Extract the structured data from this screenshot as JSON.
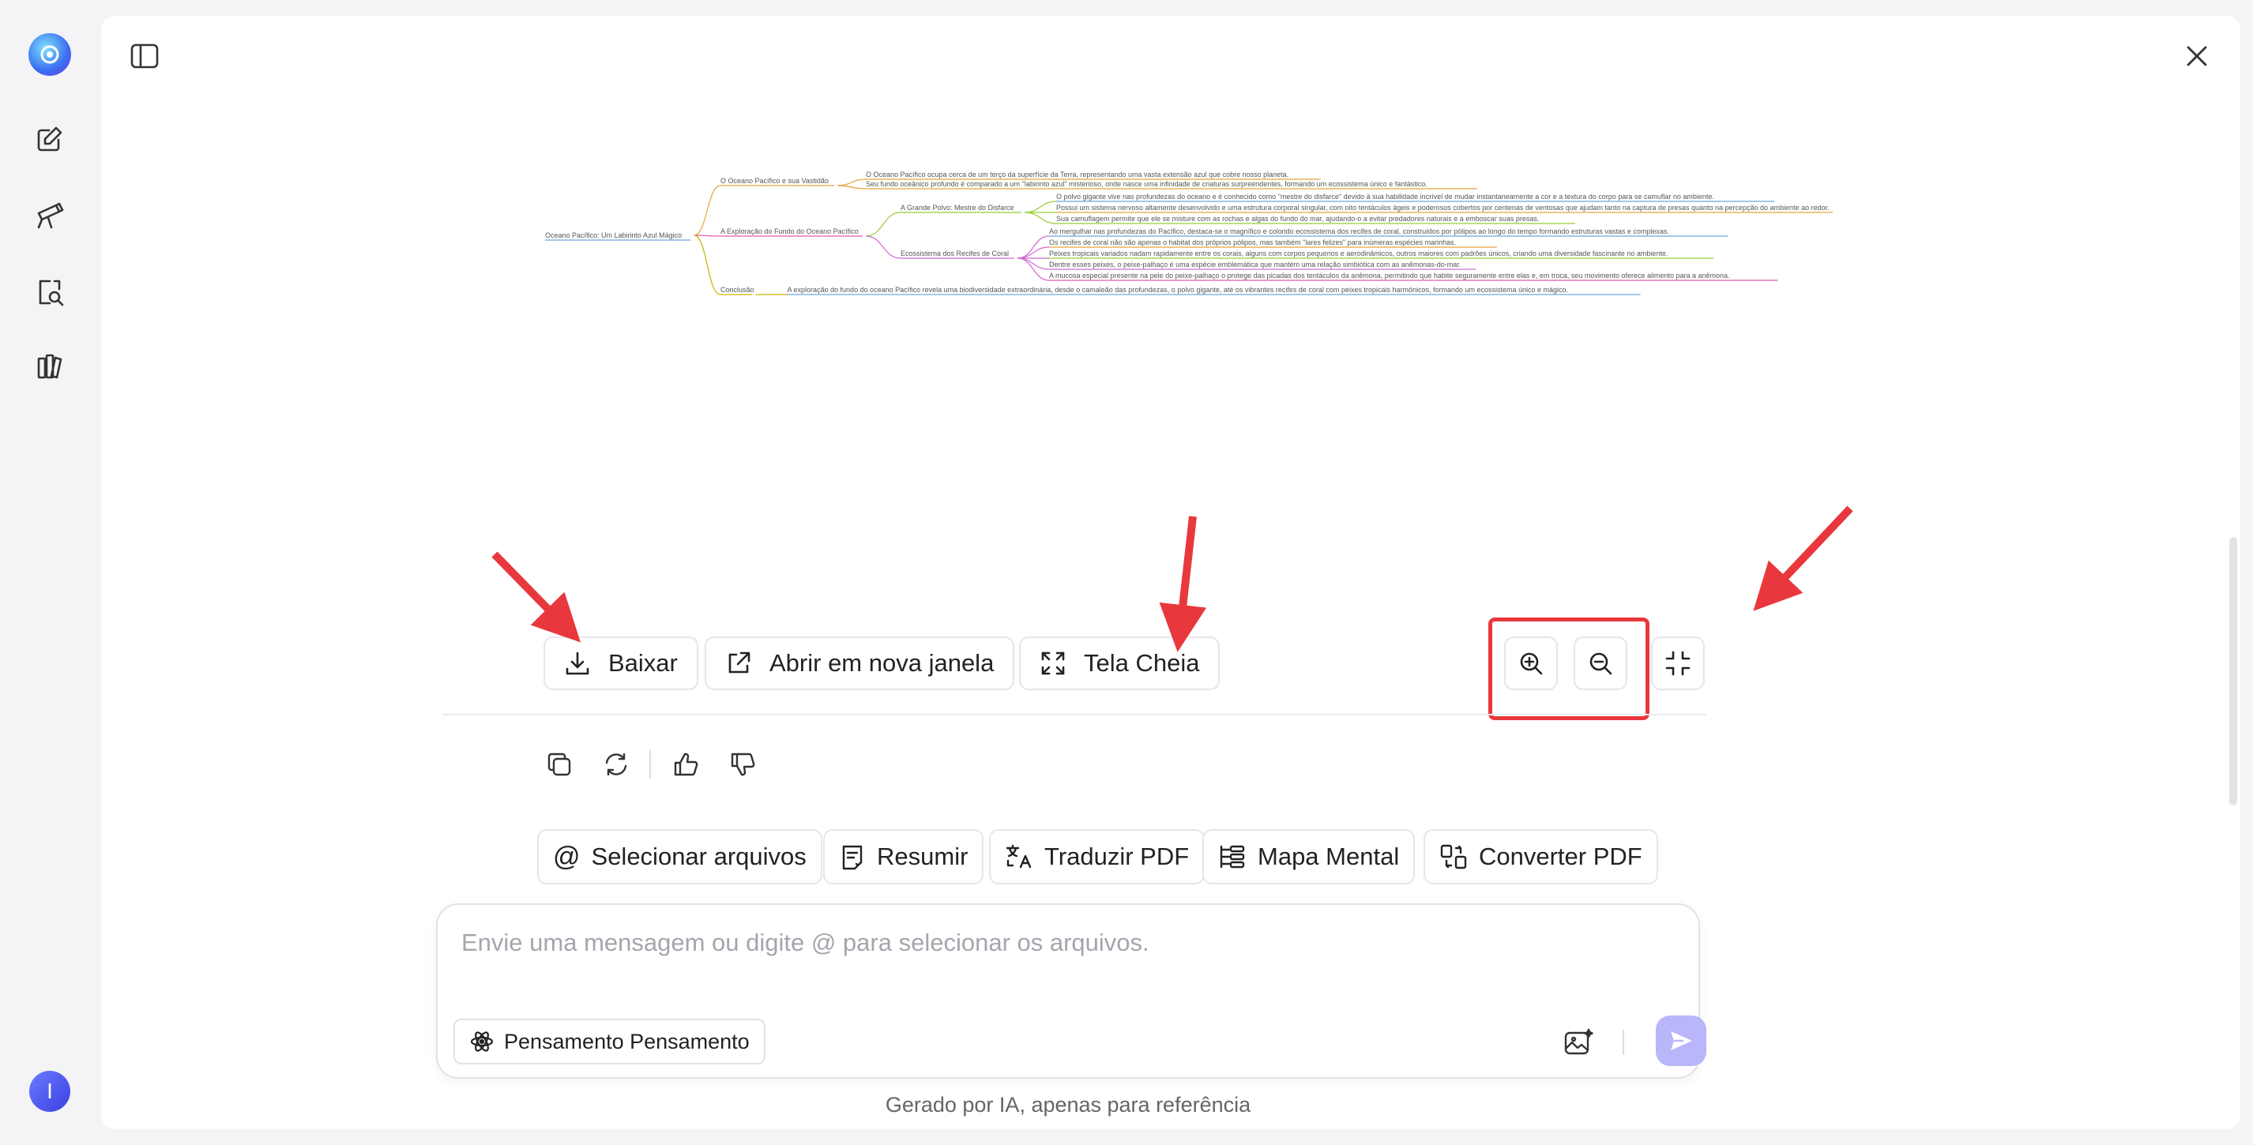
{
  "toolbar": {
    "download_label": "Baixar",
    "open_new_window_label": "Abrir em nova janela",
    "fullscreen_label": "Tela Cheia"
  },
  "chips": [
    {
      "label": "Selecionar arquivos",
      "icon": "at-icon"
    },
    {
      "label": "Resumir",
      "icon": "summary-icon"
    },
    {
      "label": "Traduzir PDF",
      "icon": "translate-icon"
    },
    {
      "label": "Mapa Mental",
      "icon": "mindmap-icon"
    },
    {
      "label": "Converter PDF",
      "icon": "convert-icon"
    }
  ],
  "input": {
    "placeholder": "Envie uma mensagem ou digite @ para selecionar os arquivos.",
    "thinking_label": "Pensamento Pensamento"
  },
  "footnote": "Gerado por IA, apenas para referência",
  "user": {
    "avatar_initial": "I"
  },
  "mindmap": {
    "root": "Oceano Pacífico: Um Labirinto Azul Mágico",
    "branches": [
      {
        "label": "O Oceano Pacífico e sua Vastidão",
        "color": "#e6a23c",
        "children": [
          "O Oceano Pacífico ocupa cerca de um terço da superfície da Terra, representando uma vasta extensão azul que cobre nosso planeta.",
          "Seu fundo oceânico profundo é comparado a um \"labirinto azul\" misterioso, onde nasce uma infinidade de criaturas surpreendentes, formando um ecossistema único e fantástico."
        ]
      },
      {
        "label": "A Exploração do Fundo do Oceano Pacífico",
        "color": "#e85aa8",
        "children": []
      },
      {
        "label": "Conclusão",
        "color": "#c8b400",
        "children": [
          "A exploração do fundo do oceano Pacífico revela uma biodiversidade extraordinária, desde o camaleão das profundezas, o polvo gigante, até os vibrantes recifes de coral com peixes tropicais harmônicos, formando um ecossistema único e mágico."
        ]
      }
    ],
    "sub_branches": [
      {
        "label": "A Grande Polvo: Mestre do Disfarce",
        "color": "#9acd32",
        "children": [
          "O polvo gigante vive nas profundezas do oceano e é conhecido como \"mestre do disfarce\" devido à sua habilidade incrível de mudar instantaneamente a cor e a textura do corpo para se camuflar no ambiente.",
          "Possui um sistema nervoso altamente desenvolvido e uma estrutura corporal singular, com oito tentáculos ágeis e poderosos cobertos por centenas de ventosas que ajudam tanto na captura de presas quanto na percepção do ambiente ao redor.",
          "Sua camuflagem permite que ele se misture com as rochas e algas do fundo do mar, ajudando-o a evitar predadores naturais e a emboscar suas presas."
        ]
      },
      {
        "label": "Ecossistema dos Recifes de Coral",
        "color": "#d06ad0",
        "children": [
          "Ao mergulhar nas profundezas do Pacífico, destaca-se o magnífico e colorido ecossistema dos recifes de coral, construídos por pólipos ao longo do tempo formando estruturas vastas e complexas.",
          "Os recifes de coral não são apenas o habitat dos próprios pólipos, mas também \"lares felizes\" para inúmeras espécies marinhas.",
          "Peixes tropicais variados nadam rapidamente entre os corais, alguns com corpos pequenos e aerodinâmicos, outros maiores com padrões únicos, criando uma diversidade fascinante no ambiente.",
          "Dentre esses peixes, o peixe-palhaço é uma espécie emblemática que mantém uma relação simbiótica com as anêmonas-do-mar.",
          "A mucosa especial presente na pele do peixe-palhaço o protege das picadas dos tentáculos da anêmona, permitindo que habite seguramente entre elas e, em troca, seu movimento oferece alimento para a anêmona."
        ]
      }
    ]
  },
  "colors": {
    "accent": "#6b6cf6",
    "highlight": "#e8383d",
    "send_bg": "#b9b6f9"
  }
}
